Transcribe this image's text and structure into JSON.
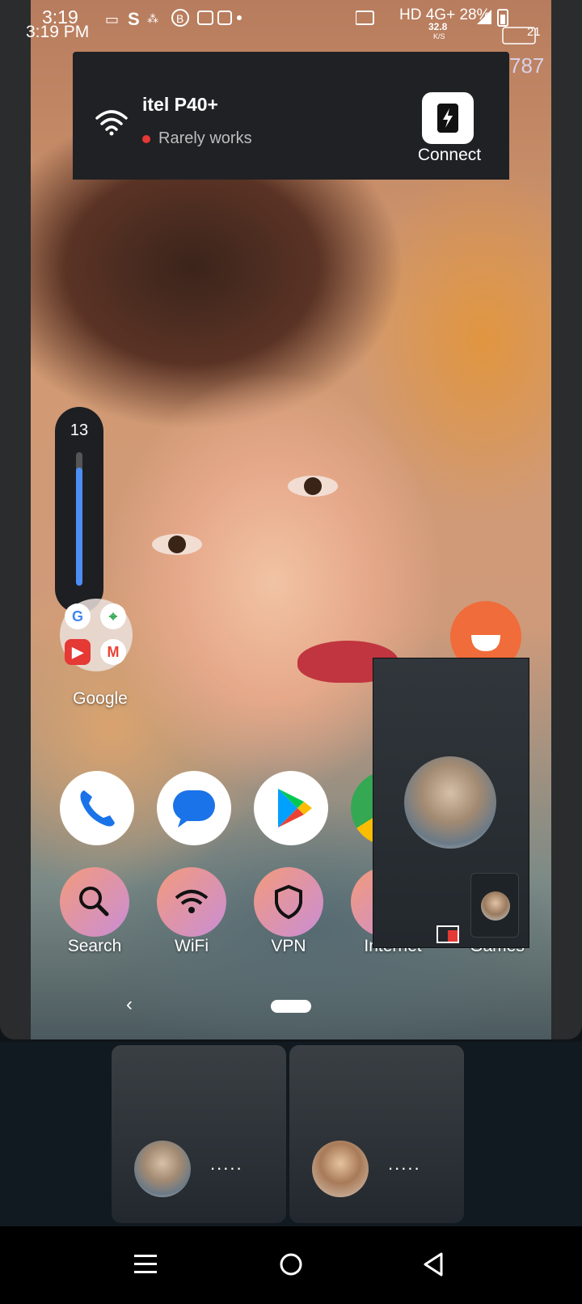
{
  "status_bar": {
    "time_primary": "3:19",
    "time_secondary": "3:19 PM",
    "right_text": "HD 4G+ 28%",
    "net_speed": "32.8",
    "net_unit": "K/S",
    "badge": "21",
    "partial_number": "787"
  },
  "notification": {
    "network_name": "itel P40+",
    "status": "Rarely works",
    "connect_label": "Connect"
  },
  "volume": {
    "level": "13",
    "fraction": 0.88
  },
  "home": {
    "folder_label": "Google",
    "quick_actions": [
      "Search",
      "WiFi",
      "VPN",
      "Internet",
      "Games"
    ]
  },
  "call_tiles": [
    {
      "dots": "....."
    },
    {
      "dots": "....."
    }
  ],
  "colors": {
    "accent_blue": "#4c8df6",
    "alert_red": "#e53935",
    "orange": "#f06c3a"
  }
}
